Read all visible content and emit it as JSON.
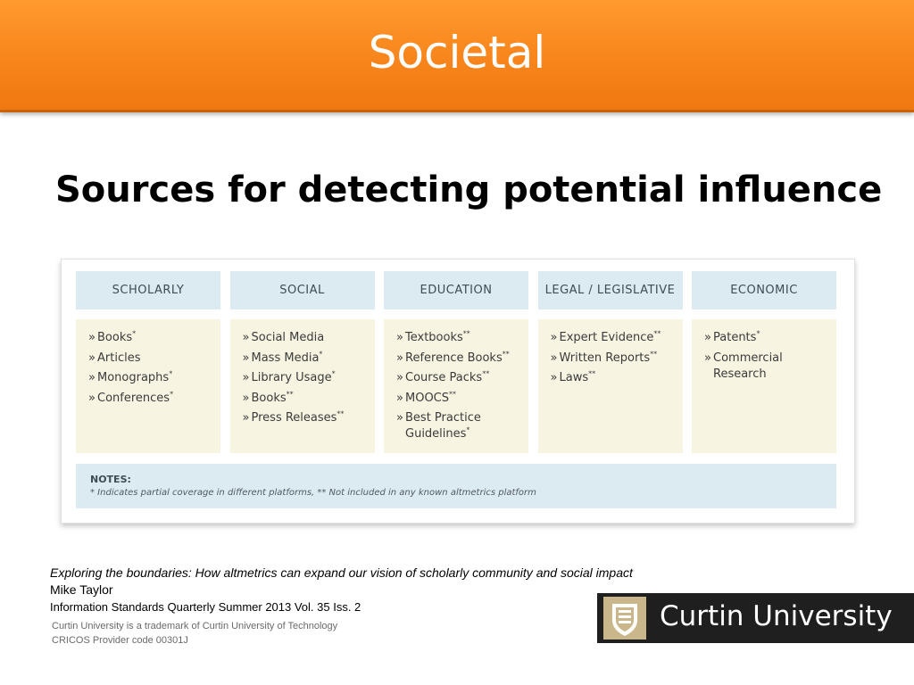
{
  "header": {
    "title": "Societal"
  },
  "slide": {
    "title": "Sources for detecting potential influence"
  },
  "table": {
    "columns": [
      {
        "header": "SCHOLARLY",
        "items": [
          {
            "text": "Books",
            "mark": "*"
          },
          {
            "text": "Articles",
            "mark": ""
          },
          {
            "text": "Monographs",
            "mark": "*"
          },
          {
            "text": "Conferences",
            "mark": "*"
          }
        ]
      },
      {
        "header": "SOCIAL",
        "items": [
          {
            "text": "Social Media",
            "mark": ""
          },
          {
            "text": "Mass Media",
            "mark": "*"
          },
          {
            "text": "Library Usage",
            "mark": "*"
          },
          {
            "text": "Books",
            "mark": "**"
          },
          {
            "text": "Press Releases",
            "mark": "**"
          }
        ]
      },
      {
        "header": "EDUCATION",
        "items": [
          {
            "text": "Textbooks",
            "mark": "**"
          },
          {
            "text": "Reference Books",
            "mark": "**"
          },
          {
            "text": "Course Packs",
            "mark": "**"
          },
          {
            "text": "MOOCS",
            "mark": "**"
          },
          {
            "text": "Best Practice Guidelines",
            "mark": "*"
          }
        ]
      },
      {
        "header": "LEGAL / LEGISLATIVE",
        "items": [
          {
            "text": "Expert Evidence",
            "mark": "**"
          },
          {
            "text": "Written Reports",
            "mark": "**"
          },
          {
            "text": "Laws",
            "mark": "**"
          }
        ]
      },
      {
        "header": "ECONOMIC",
        "items": [
          {
            "text": "Patents",
            "mark": "*"
          },
          {
            "text": "Commercial Research",
            "mark": ""
          }
        ]
      }
    ],
    "notes": {
      "title": "NOTES:",
      "text": "* Indicates partial coverage in different platforms, ** Not included in any known altmetrics platform"
    }
  },
  "citation": {
    "title": "Exploring the boundaries: How altmetrics can expand our vision of scholarly community and social impact",
    "author": "Mike Taylor",
    "source": "Information Standards Quarterly Summer 2013 Vol. 35 Iss. 2"
  },
  "footer": {
    "trademark": "Curtin University is a trademark of Curtin University of Technology",
    "cricos": "CRICOS Provider code  00301J"
  },
  "logo": {
    "text": "Curtin University",
    "emblem_icon": "curtin-crest-icon"
  },
  "colors": {
    "banner": "#f7851c",
    "header_cell": "#dceaf1",
    "body_cell": "#f7f4e2",
    "logo_bg": "#1f1f1f"
  }
}
